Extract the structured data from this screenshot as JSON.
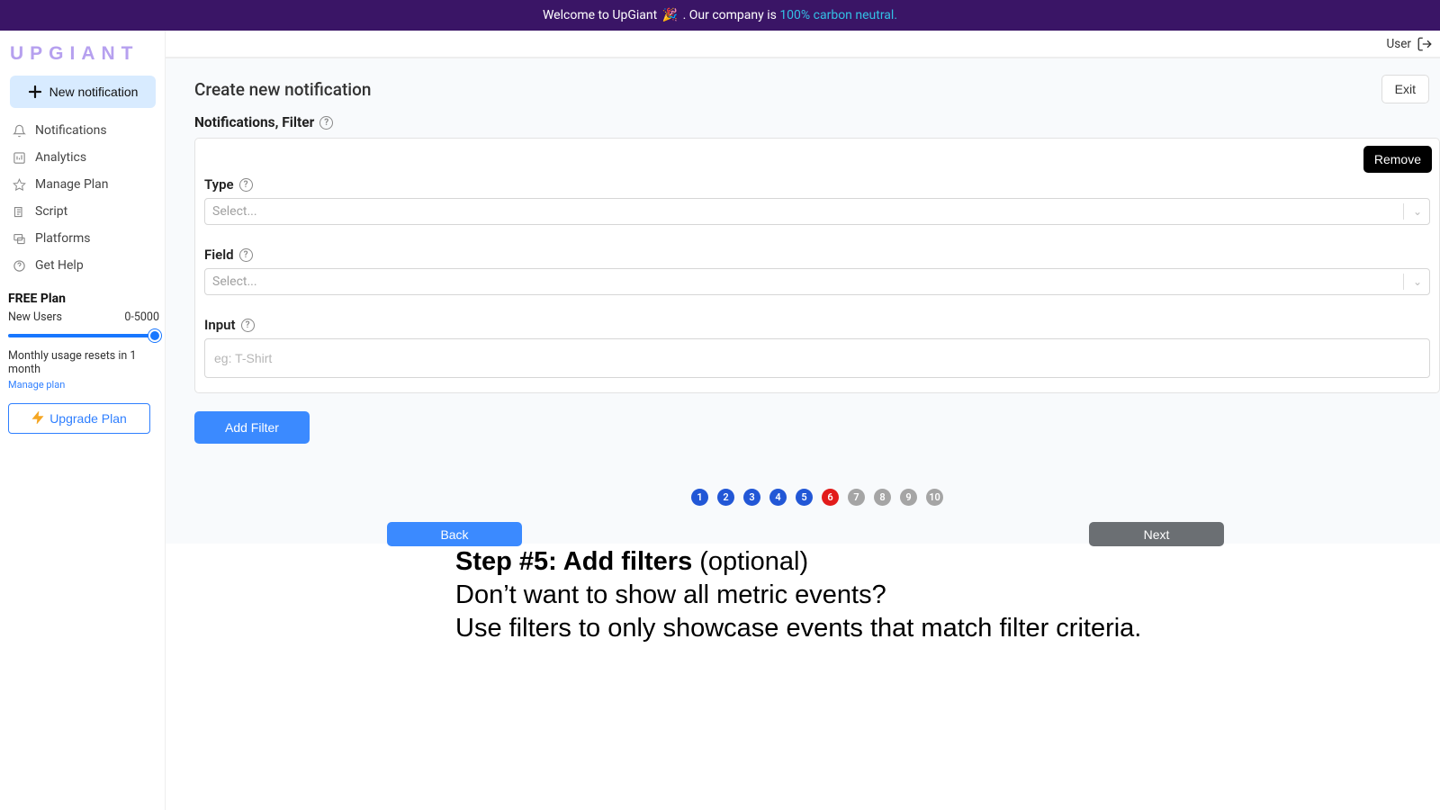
{
  "banner": {
    "text1": "Welcome to UpGiant ",
    "emoji": "🎉",
    "text2": " . Our company is ",
    "link": "100% carbon neutral."
  },
  "brand": "UPGIANT",
  "sidebar": {
    "new_label": "New notification",
    "items": [
      {
        "label": "Notifications"
      },
      {
        "label": "Analytics"
      },
      {
        "label": "Manage Plan"
      },
      {
        "label": "Script"
      },
      {
        "label": "Platforms"
      },
      {
        "label": "Get Help"
      }
    ],
    "plan": {
      "title": "FREE Plan",
      "metric": "New Users",
      "range": "0-5000",
      "reset": "Monthly usage resets in 1 month",
      "manage": "Manage plan"
    },
    "upgrade": "Upgrade Plan"
  },
  "topbar": {
    "user": "User"
  },
  "main": {
    "title": "Create new notification",
    "exit": "Exit",
    "section": "Notifications, Filter",
    "remove": "Remove",
    "labels": {
      "type": "Type",
      "field": "Field",
      "input": "Input"
    },
    "select_placeholder": "Select...",
    "input_placeholder": "eg: T-Shirt",
    "add": "Add Filter",
    "back": "Back",
    "next": "Next",
    "steps": [
      "1",
      "2",
      "3",
      "4",
      "5",
      "6",
      "7",
      "8",
      "9",
      "10"
    ],
    "current_step": 6
  },
  "caption": {
    "l1_bold": "Step #5: Add filters",
    "l1_rest": " (optional)",
    "l2": "Don’t want to show all metric events?",
    "l3": "Use filters to only showcase events that match filter criteria."
  }
}
